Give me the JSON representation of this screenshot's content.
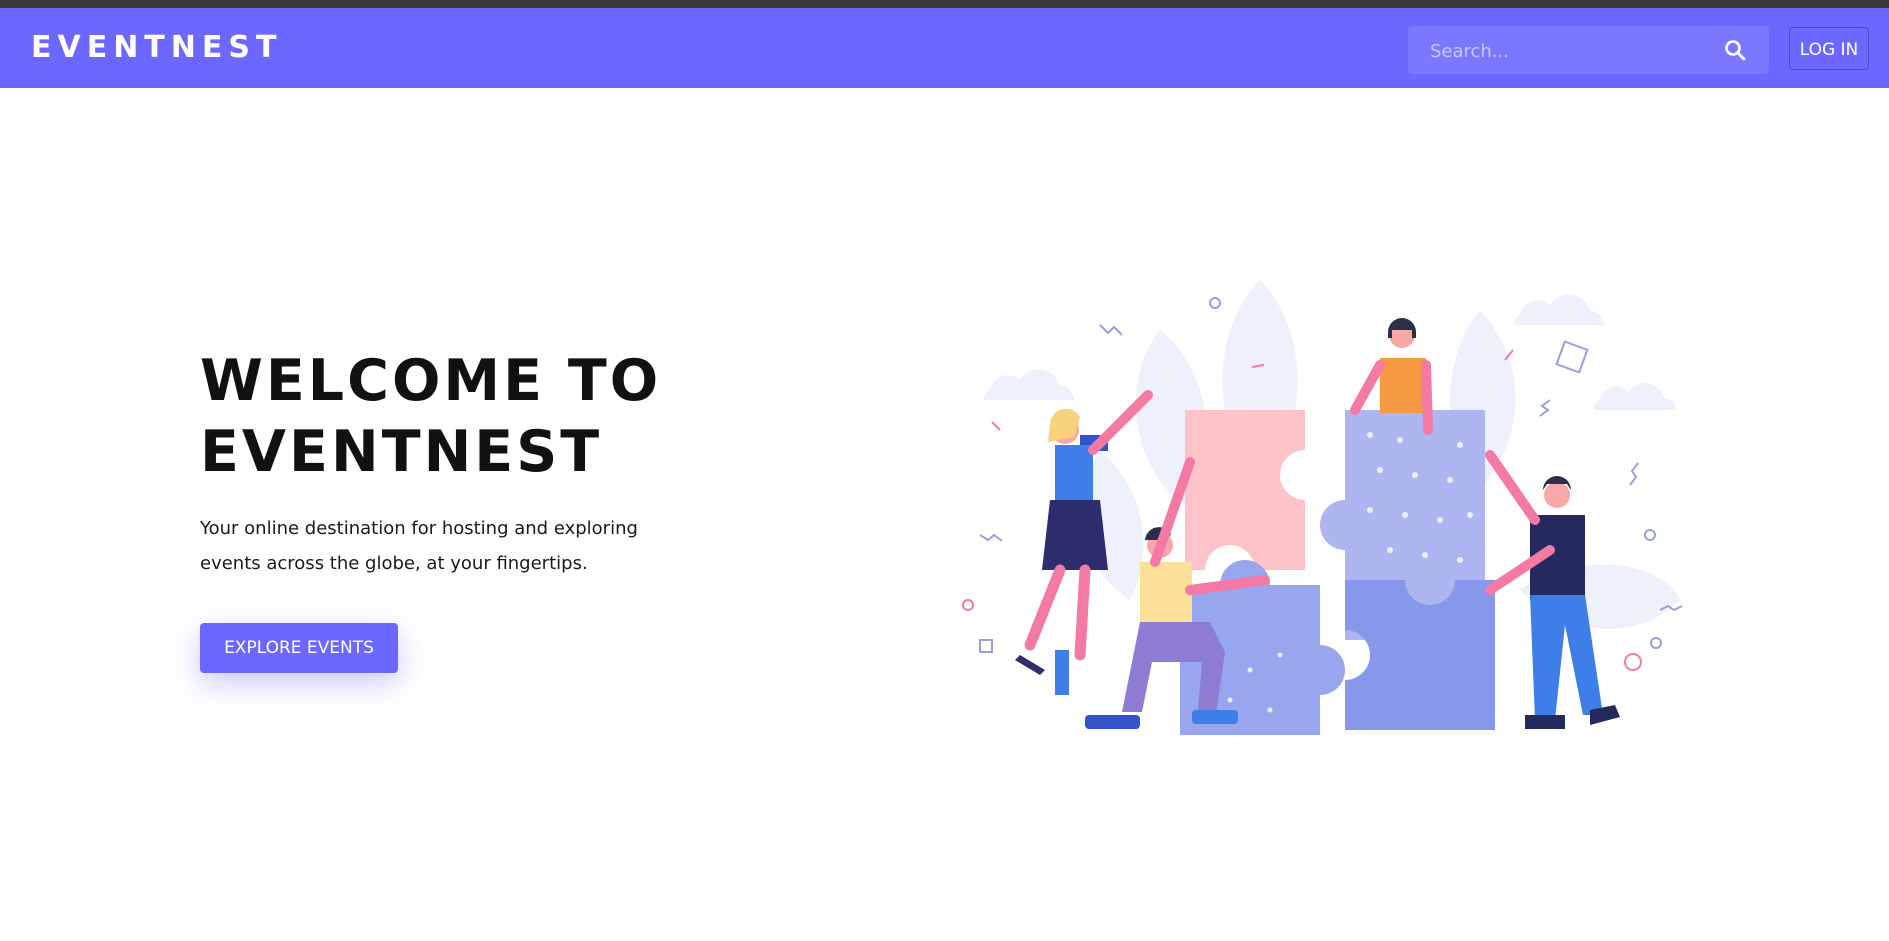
{
  "header": {
    "brand": "EVENTNEST",
    "search_placeholder": "Search...",
    "login_label": "LOG IN",
    "color": "#6c67ff"
  },
  "hero": {
    "title_line1": "WELCOME TO",
    "title_line2": "EVENTNEST",
    "subtitle_line1": "Your online destination for hosting and exploring",
    "subtitle_line2": "events across the globe, at your fingertips.",
    "cta_label": "EXPLORE EVENTS"
  },
  "icons": {
    "search": "search-icon"
  }
}
